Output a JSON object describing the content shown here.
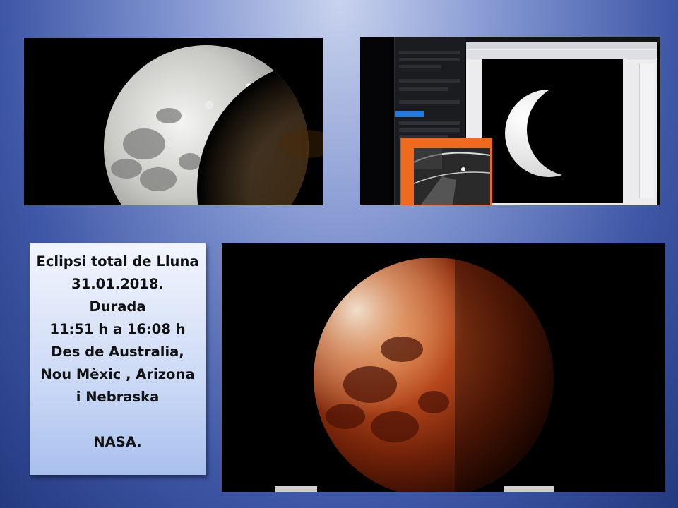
{
  "caption": {
    "line1": "Eclipsi total de Lluna",
    "line2": "31.01.2018.",
    "line3": "Durada",
    "line4": "11:51 h a 16:08 h",
    "line5": "Des de Australia,",
    "line6": "Nou Mèxic , Arizona",
    "line7": "i Nebraska",
    "line8": "NASA."
  },
  "photos": [
    {
      "name": "partial-eclipse-moon",
      "description_visible": "grey moon partially shadowed"
    },
    {
      "name": "telescope-software-screenshot",
      "description_visible": "computer screen with crescent moon"
    },
    {
      "name": "total-eclipse-blood-moon",
      "description_visible": "red moon during totality"
    }
  ],
  "colors": {
    "background_top": "#c9d3ee",
    "background_bottom": "#24397f",
    "text": "#111111",
    "caption_box": "#cfdcf6",
    "blood_moon": "#a33a10",
    "software_accent": "#f06a1e"
  }
}
